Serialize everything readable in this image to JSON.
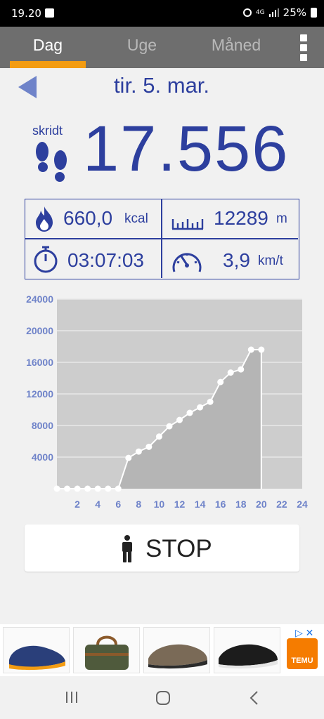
{
  "status_bar": {
    "time": "19.20",
    "battery": "25%",
    "network": "4G"
  },
  "tabs": [
    {
      "label": "Dag",
      "active": true
    },
    {
      "label": "Uge",
      "active": false
    },
    {
      "label": "Måned",
      "active": false
    }
  ],
  "date": "tir. 5. mar.",
  "steps": {
    "label": "skridt",
    "value": "17.556"
  },
  "stats": {
    "calories": {
      "value": "660,0",
      "unit": "kcal",
      "icon": "flame-icon"
    },
    "distance": {
      "value": "12289",
      "unit": "m",
      "icon": "ruler-icon"
    },
    "duration": {
      "value": "03:07:03",
      "icon": "stopwatch-icon"
    },
    "speed": {
      "value": "3,9",
      "unit": "km/t",
      "icon": "speedometer-icon"
    }
  },
  "chart_data": {
    "type": "line",
    "x": [
      0,
      1,
      2,
      3,
      4,
      5,
      6,
      7,
      8,
      9,
      10,
      11,
      12,
      13,
      14,
      15,
      16,
      17,
      18,
      19,
      20
    ],
    "y": [
      0,
      0,
      0,
      0,
      0,
      0,
      0,
      3900,
      4700,
      5300,
      6600,
      7900,
      8700,
      9600,
      10300,
      11000,
      13500,
      14700,
      15100,
      17600,
      17600
    ],
    "xticks": [
      "2",
      "4",
      "6",
      "8",
      "10",
      "12",
      "14",
      "16",
      "18",
      "20",
      "22",
      "24"
    ],
    "yticks": [
      "4000",
      "8000",
      "12000",
      "16000",
      "20000",
      "24000"
    ],
    "xlim": [
      0,
      24
    ],
    "ylim": [
      0,
      24000
    ],
    "current_x": 20,
    "grid": true,
    "colors": {
      "area": "#b5b5b5",
      "background": "#cdcdcd",
      "line": "#ffffff",
      "tick_label": "#6f83c9"
    }
  },
  "stop_button": {
    "label": "STOP",
    "icon": "person-icon"
  },
  "ad": {
    "brand": "TEMU",
    "products": [
      "slip-on-shoe",
      "travel-bag",
      "loafer-shoe",
      "black-loafer"
    ]
  },
  "colors": {
    "primary": "#2d3f9e",
    "accent": "#f39c12",
    "tab_bar": "#6e6e6e"
  }
}
